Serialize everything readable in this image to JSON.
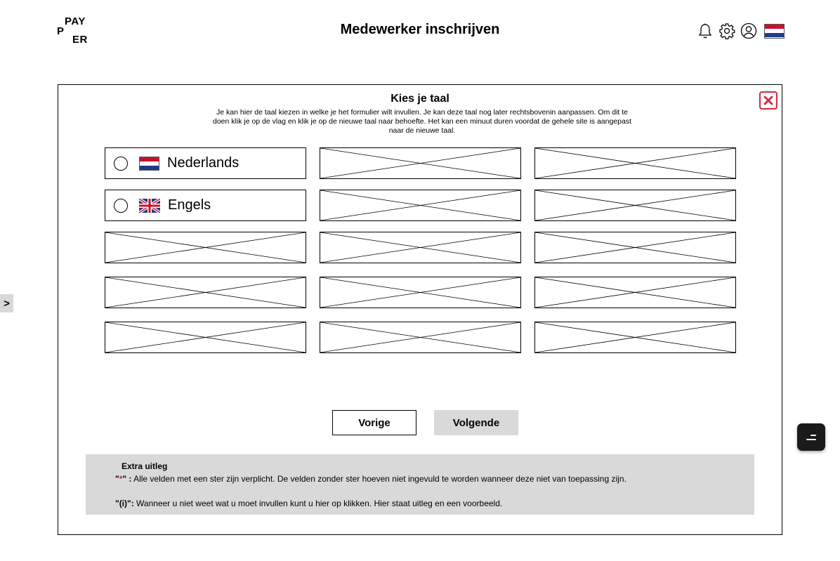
{
  "header": {
    "logo": {
      "line1": "PAY",
      "line2": "P",
      "line3": "ER"
    },
    "title": "Medewerker inschrijven",
    "icons": [
      "bell-icon",
      "gear-icon",
      "user-icon",
      "flag-nl-icon"
    ]
  },
  "side_toggle": ">",
  "modal": {
    "title": "Kies je taal",
    "description": "Je kan hier de taal kiezen in welke je het formulier wilt invullen. Je kan deze taal nog later rechtsbovenin aanpassen. Om dit te doen klik je op de vlag en klik je op de nieuwe taal naar behoefte. Het kan een minuut duren voordat de gehele site is aangepast naar de nieuwe taal.",
    "languages": [
      {
        "label": "Nederlands",
        "flag": "flag-nl",
        "selected": false
      },
      {
        "label": "Engels",
        "flag": "flag-uk",
        "selected": false
      }
    ],
    "placeholder_count": 13,
    "buttons": {
      "prev": "Vorige",
      "next": "Volgende"
    },
    "info": {
      "title": "Extra uitleg",
      "required_prefix": "\"",
      "required_star": "*",
      "required_suffix": "\" :",
      "required_text": " Alle velden met een ster zijn verplicht. De velden zonder ster hoeven niet ingevuld te worden wanneer deze niet van toepassing zijn.",
      "info_prefix": "\"(i)\":",
      "info_text": " Wanneer u niet weet wat u moet invullen kunt u hier op klikken. Hier staat uitleg en een voorbeeld."
    }
  },
  "colors": {
    "accent_red": "#d7263d",
    "gray": "#d9d9d9"
  }
}
